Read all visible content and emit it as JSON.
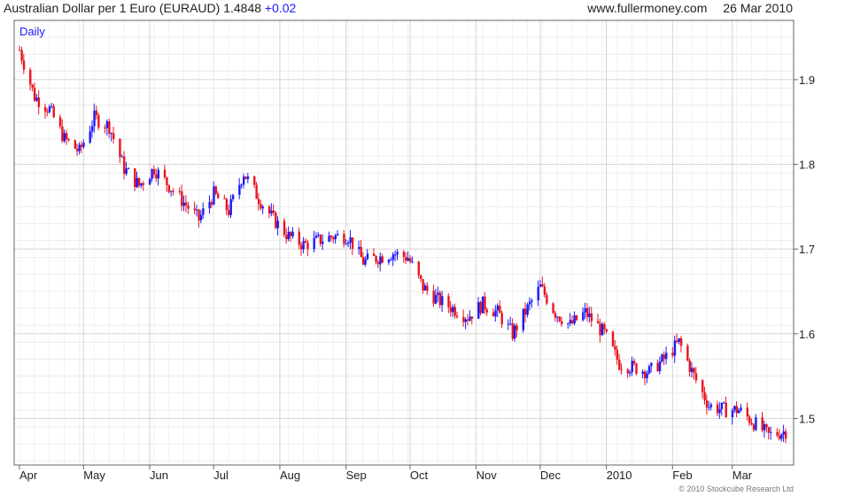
{
  "header": {
    "title": "Australian Dollar per 1 Euro (EURAUD)",
    "last": "1.4848",
    "change": "+0.02",
    "site": "www.fullermoney.com",
    "date": "26 Mar 2010"
  },
  "footer": {
    "copyright": "© 2010 Stockcube Research Ltd"
  },
  "colors": {
    "up": "#1a1aff",
    "down": "#e8141d",
    "grid": "#d4d4d4",
    "frame": "#666666"
  },
  "chart_data": {
    "type": "candlestick",
    "interval_label": "Daily",
    "x_ticks": [
      "Apr",
      "May",
      "Jun",
      "Jul",
      "Aug",
      "Sep",
      "Oct",
      "Nov",
      "Dec",
      "2010",
      "Feb",
      "Mar"
    ],
    "y_ticks": [
      "1.9",
      "1.8",
      "1.7",
      "1.6",
      "1.5"
    ],
    "ylim": [
      1.445,
      1.97
    ],
    "x_range": [
      "2009-04-01",
      "2010-03-26"
    ],
    "grid": true,
    "axis_side": "right",
    "series": [
      {
        "values": [
          [
            "2009-04-01",
            1.935
          ],
          [
            "2009-04-08",
            1.88
          ],
          [
            "2009-04-15",
            1.865
          ],
          [
            "2009-04-22",
            1.83
          ],
          [
            "2009-04-29",
            1.815
          ],
          [
            "2009-05-06",
            1.855
          ],
          [
            "2009-05-13",
            1.845
          ],
          [
            "2009-05-20",
            1.795
          ],
          [
            "2009-05-27",
            1.775
          ],
          [
            "2009-06-03",
            1.795
          ],
          [
            "2009-06-10",
            1.775
          ],
          [
            "2009-06-17",
            1.755
          ],
          [
            "2009-06-24",
            1.735
          ],
          [
            "2009-07-01",
            1.765
          ],
          [
            "2009-07-08",
            1.745
          ],
          [
            "2009-07-15",
            1.79
          ],
          [
            "2009-07-22",
            1.76
          ],
          [
            "2009-07-29",
            1.735
          ],
          [
            "2009-08-05",
            1.715
          ],
          [
            "2009-08-12",
            1.705
          ],
          [
            "2009-08-19",
            1.71
          ],
          [
            "2009-08-26",
            1.715
          ],
          [
            "2009-09-02",
            1.715
          ],
          [
            "2009-09-09",
            1.685
          ],
          [
            "2009-09-16",
            1.69
          ],
          [
            "2009-09-23",
            1.695
          ],
          [
            "2009-09-30",
            1.69
          ],
          [
            "2009-10-07",
            1.655
          ],
          [
            "2009-10-14",
            1.64
          ],
          [
            "2009-10-21",
            1.63
          ],
          [
            "2009-10-28",
            1.62
          ],
          [
            "2009-11-04",
            1.635
          ],
          [
            "2009-11-11",
            1.625
          ],
          [
            "2009-11-18",
            1.6
          ],
          [
            "2009-11-25",
            1.63
          ],
          [
            "2009-12-01",
            1.655
          ],
          [
            "2009-12-08",
            1.625
          ],
          [
            "2009-12-15",
            1.61
          ],
          [
            "2009-12-22",
            1.625
          ],
          [
            "2009-12-31",
            1.6
          ],
          [
            "2010-01-07",
            1.565
          ],
          [
            "2010-01-14",
            1.56
          ],
          [
            "2010-01-21",
            1.555
          ],
          [
            "2010-01-28",
            1.57
          ],
          [
            "2010-02-04",
            1.59
          ],
          [
            "2010-02-11",
            1.55
          ],
          [
            "2010-02-18",
            1.515
          ],
          [
            "2010-02-25",
            1.51
          ],
          [
            "2010-03-04",
            1.51
          ],
          [
            "2010-03-11",
            1.495
          ],
          [
            "2010-03-18",
            1.48
          ],
          [
            "2010-03-26",
            1.4848
          ]
        ]
      }
    ]
  }
}
